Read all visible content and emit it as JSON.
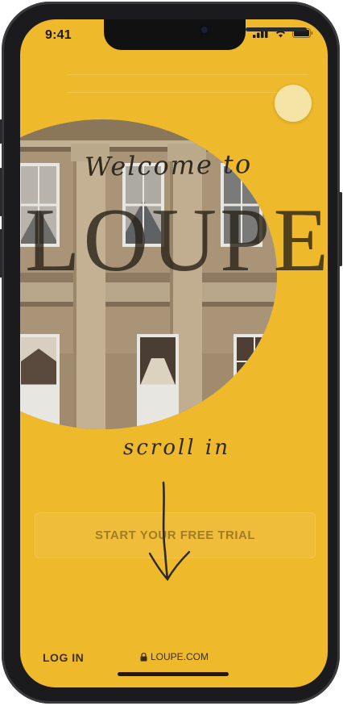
{
  "status_bar": {
    "time": "9:41",
    "icons": [
      "signal-icon",
      "wifi-icon",
      "battery-icon"
    ]
  },
  "hero": {
    "welcome_text": "Welcome to",
    "brand_text": "LOUPE",
    "scroll_hint": "scroll in",
    "toggle_color": "#f5e4a6"
  },
  "cta": {
    "label": "START YOUR FREE TRIAL"
  },
  "footer": {
    "login_label": "LOG IN",
    "url_label": "LOUPE.COM"
  },
  "colors": {
    "background": "#efb92c",
    "text_dark": "#2e2a20",
    "phone_frame": "#1b1b1d"
  }
}
